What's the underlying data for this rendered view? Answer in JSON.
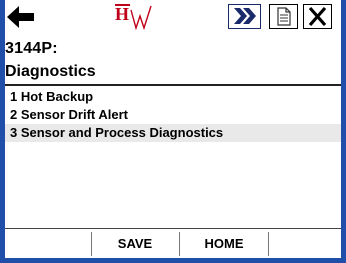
{
  "toolbar": {
    "back_icon": "left-arrow-icon",
    "logo_text": "H",
    "logo_icon": "hart-logo-icon",
    "forward_icon": "double-chevron-right-icon",
    "document_icon": "document-icon",
    "close_icon": "close-icon",
    "accent_color": "#1f4fa8"
  },
  "header": {
    "device_tag": "3144P:",
    "title": "Diagnostics"
  },
  "menu": {
    "items": [
      {
        "label": "1 Hot Backup"
      },
      {
        "label": "2 Sensor Drift Alert"
      },
      {
        "label": "3 Sensor and Process Diagnostics",
        "selected": true
      }
    ]
  },
  "softkeys": {
    "save_label": "SAVE",
    "home_label": "HOME"
  }
}
